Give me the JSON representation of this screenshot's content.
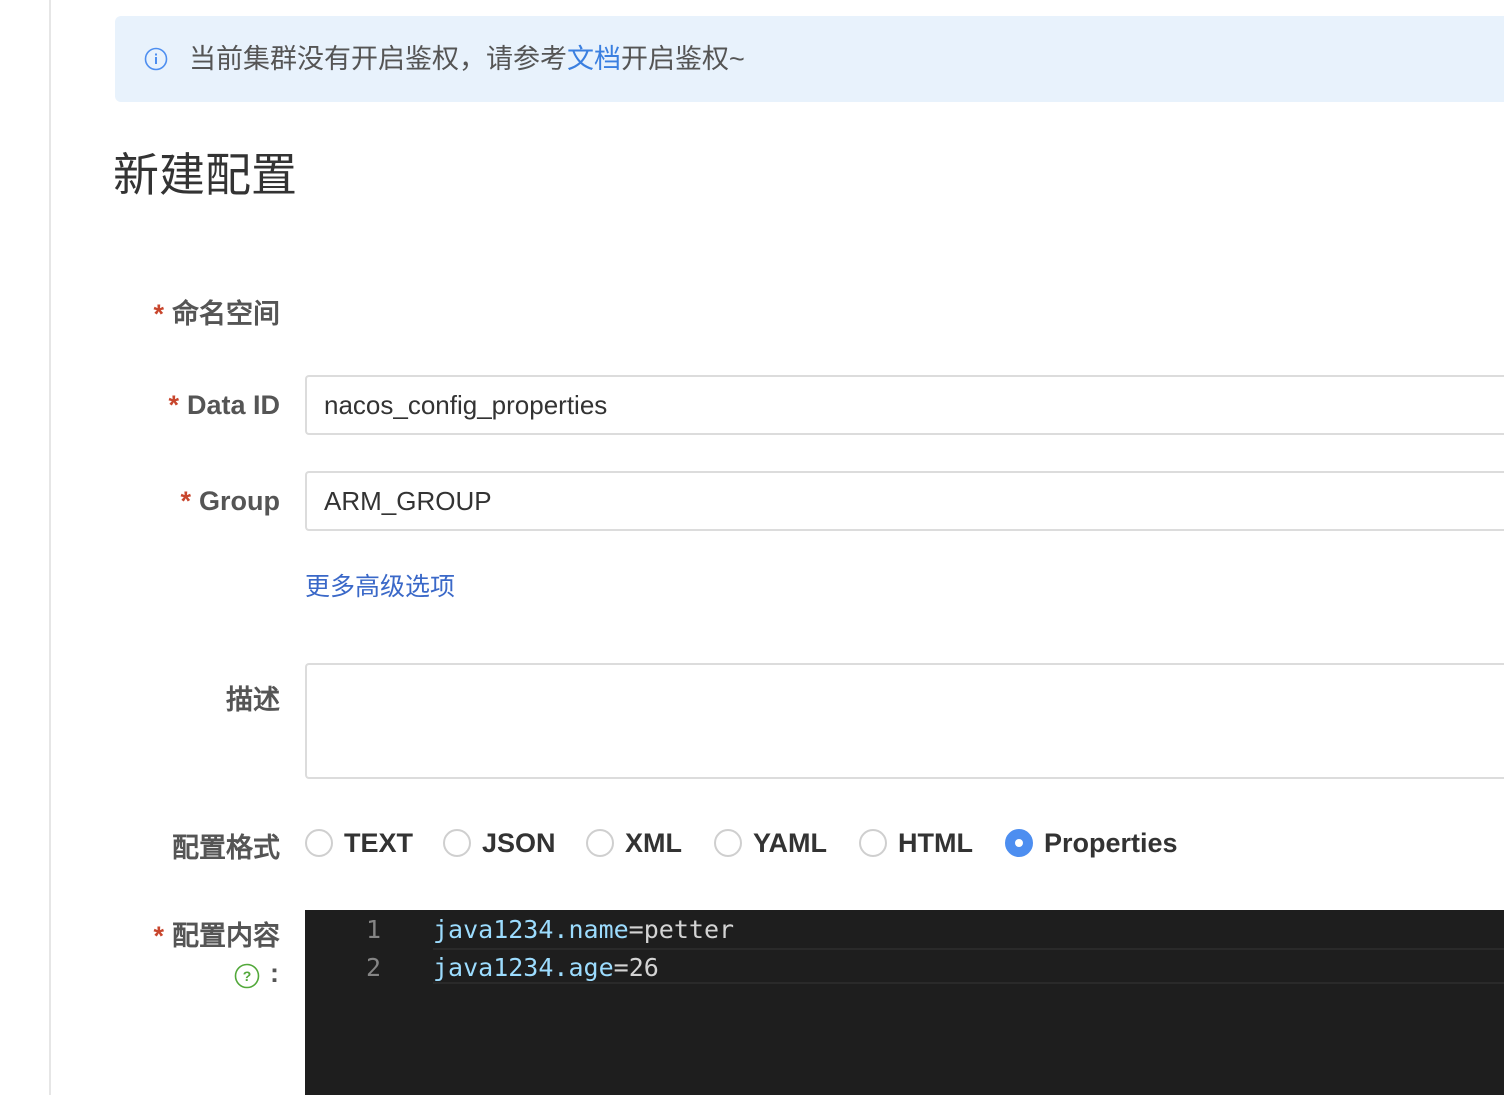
{
  "notice": {
    "icon": "info-icon",
    "text_before": "当前集群没有开启鉴权，请参考",
    "link_label": "文档",
    "text_after": "开启鉴权~"
  },
  "page_title": "新建配置",
  "form": {
    "namespace_label": "命名空间",
    "data_id_label": "Data ID",
    "data_id_value": "nacos_config_properties",
    "group_label": "Group",
    "group_value": "ARM_GROUP",
    "more_options_label": "更多高级选项",
    "description_label": "描述",
    "description_value": "",
    "format_label": "配置格式",
    "formats": [
      {
        "label": "TEXT",
        "checked": false
      },
      {
        "label": "JSON",
        "checked": false
      },
      {
        "label": "XML",
        "checked": false
      },
      {
        "label": "YAML",
        "checked": false
      },
      {
        "label": "HTML",
        "checked": false
      },
      {
        "label": "Properties",
        "checked": true
      }
    ],
    "content_label": "配置内容",
    "content_colon": ":",
    "required_mark": "*"
  },
  "editor": {
    "lines": [
      {
        "num": "1",
        "key": "java1234.name",
        "op": "=",
        "val": "petter"
      },
      {
        "num": "2",
        "key": "java1234.age",
        "op": "=",
        "val": "26"
      }
    ]
  },
  "colors": {
    "accent": "#4d8ef0",
    "link": "#3a7fe0",
    "required": "#c8462d",
    "notice_bg": "#e8f2fc",
    "editor_bg": "#1e1e1e",
    "help_icon": "#52a83a"
  }
}
